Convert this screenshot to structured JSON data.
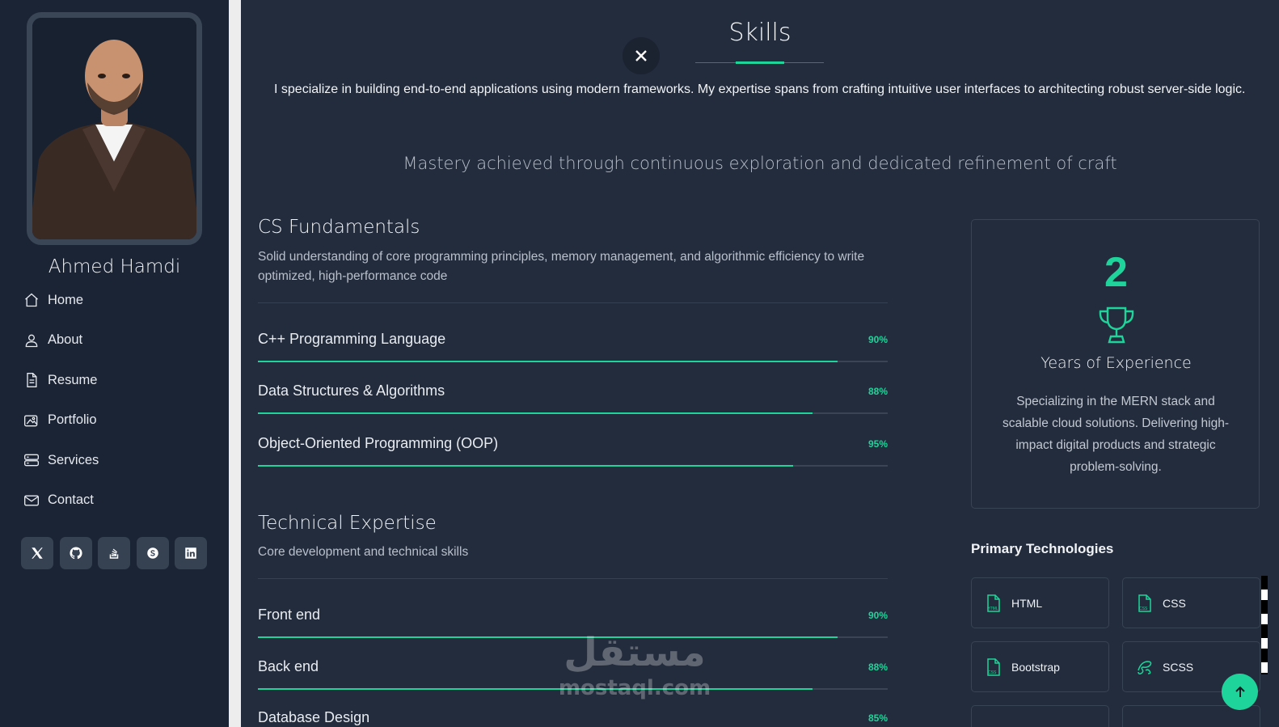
{
  "profile": {
    "name": "Ahmed Hamdi"
  },
  "nav": {
    "items": [
      {
        "label": "Home",
        "icon": "home-icon"
      },
      {
        "label": "About",
        "icon": "user-icon"
      },
      {
        "label": "Resume",
        "icon": "document-icon"
      },
      {
        "label": "Portfolio",
        "icon": "images-icon"
      },
      {
        "label": "Services",
        "icon": "server-icon"
      },
      {
        "label": "Contact",
        "icon": "envelope-icon"
      }
    ]
  },
  "socials": [
    "x-twitter-icon",
    "github-icon",
    "stack-overflow-icon",
    "skype-icon",
    "linkedin-icon"
  ],
  "skills_section": {
    "title": "Skills",
    "intro": "I specialize in building end-to-end applications using modern frameworks. My expertise spans from crafting intuitive user interfaces to architecting robust server-side logic.",
    "tagline": "Mastery achieved through continuous exploration and dedicated refinement of craft"
  },
  "groups": [
    {
      "title": "CS Fundamentals",
      "description": "Solid understanding of core programming principles, memory management, and algorithmic efficiency to write optimized, high-performance code",
      "skills": [
        {
          "name": "C++ Programming Language",
          "percent_label": "90%",
          "level": 0.92
        },
        {
          "name": "Data Structures & Algorithms",
          "percent_label": "88%",
          "level": 0.88
        },
        {
          "name": "Object-Oriented Programming (OOP)",
          "percent_label": "95%",
          "level": 0.85
        }
      ]
    },
    {
      "title": "Technical Expertise",
      "description": "Core development and technical skills",
      "skills": [
        {
          "name": "Front end",
          "percent_label": "90%",
          "level": 0.92
        },
        {
          "name": "Back end",
          "percent_label": "88%",
          "level": 0.88
        },
        {
          "name": "Database Design",
          "percent_label": "85%",
          "level": 0.85
        }
      ]
    }
  ],
  "experience": {
    "number": "2",
    "label": "Years of Experience",
    "description": "Specializing in the MERN stack and scalable cloud solutions. Delivering high-impact digital products and strategic problem-solving.",
    "icon": "trophy-icon"
  },
  "technologies": {
    "heading": "Primary Technologies",
    "items": [
      {
        "label": "HTML",
        "icon": "html-file-icon"
      },
      {
        "label": "CSS",
        "icon": "css-file-icon"
      },
      {
        "label": "Bootstrap",
        "icon": "css-file-icon"
      },
      {
        "label": "SCSS",
        "icon": "sass-icon"
      }
    ]
  },
  "watermark": {
    "arabic": "مستقل",
    "latin": "mostaql.com"
  },
  "colors": {
    "accent": "#1fd49a",
    "background": "#222c3c",
    "sidebar": "#1b2434"
  }
}
